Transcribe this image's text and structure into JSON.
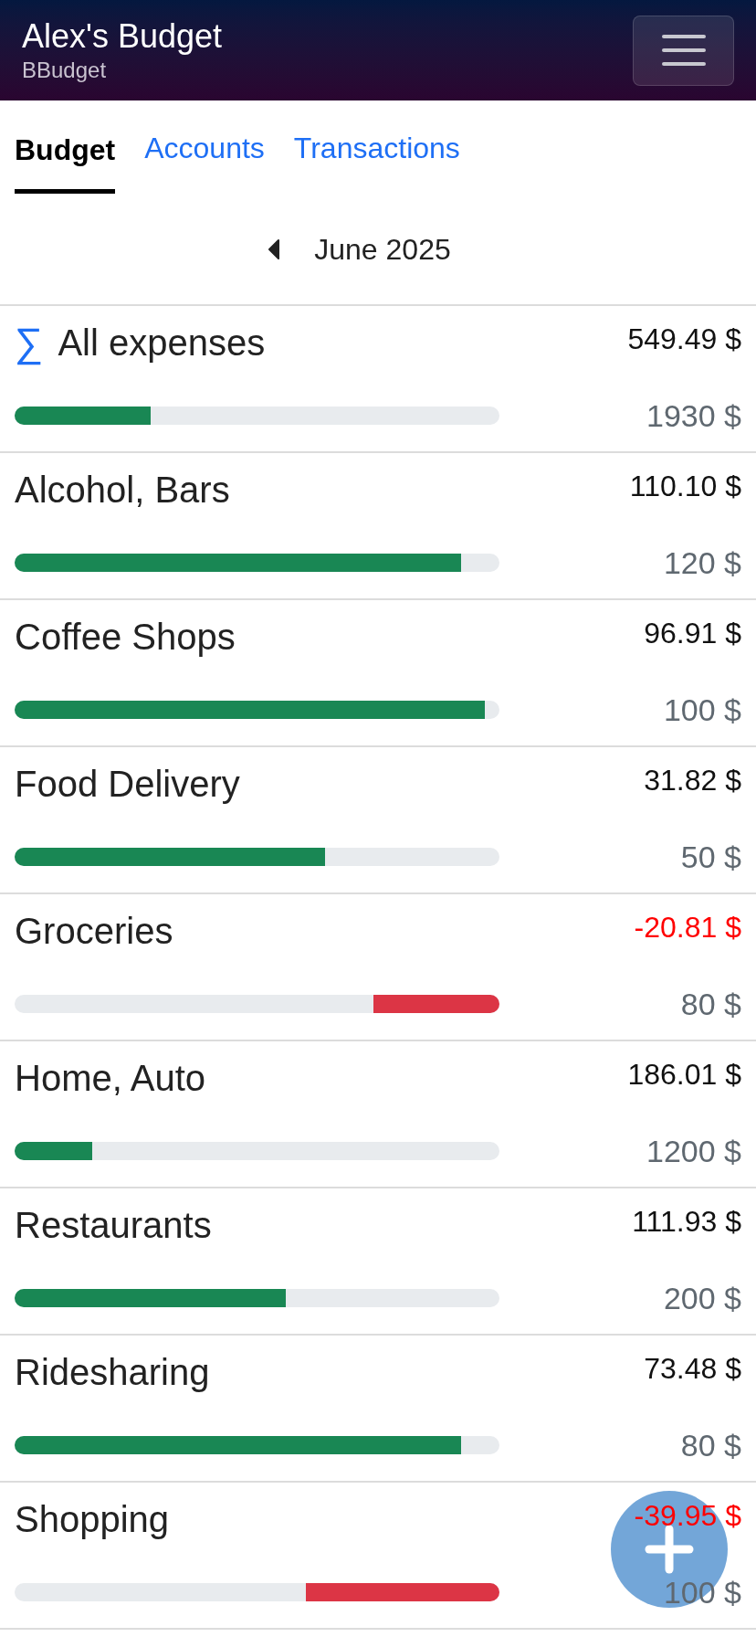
{
  "header": {
    "title": "Alex's Budget",
    "subtitle": "BBudget"
  },
  "tabs": [
    {
      "label": "Budget",
      "selected": true
    },
    {
      "label": "Accounts",
      "selected": false
    },
    {
      "label": "Transactions",
      "selected": false
    }
  ],
  "month": {
    "label": "June 2025"
  },
  "categories": [
    {
      "kind": "total",
      "icon": "∑",
      "name": "All expenses",
      "remaining": "549.49 $",
      "budget": "1930 $",
      "overspent": false,
      "level": 0.28
    },
    {
      "kind": "category",
      "name": "Alcohol, Bars",
      "remaining": "110.10 $",
      "budget": "120 $",
      "overspent": false,
      "level": 0.92
    },
    {
      "kind": "category",
      "name": "Coffee Shops",
      "remaining": "96.91 $",
      "budget": "100 $",
      "overspent": false,
      "level": 0.97
    },
    {
      "kind": "category",
      "name": "Food Delivery",
      "remaining": "31.82 $",
      "budget": "50 $",
      "overspent": false,
      "level": 0.64
    },
    {
      "kind": "category",
      "name": "Groceries",
      "remaining": "-20.81 $",
      "budget": "80 $",
      "overspent": true,
      "level": 0.26
    },
    {
      "kind": "category",
      "name": "Home, Auto",
      "remaining": "186.01 $",
      "budget": "1200 $",
      "overspent": false,
      "level": 0.16
    },
    {
      "kind": "category",
      "name": "Restaurants",
      "remaining": "111.93 $",
      "budget": "200 $",
      "overspent": false,
      "level": 0.56
    },
    {
      "kind": "category",
      "name": "Ridesharing",
      "remaining": "73.48 $",
      "budget": "80 $",
      "overspent": false,
      "level": 0.92
    },
    {
      "kind": "category",
      "name": "Shopping",
      "remaining": "-39.95 $",
      "budget": "100 $",
      "overspent": true,
      "level": 0.4
    }
  ]
}
